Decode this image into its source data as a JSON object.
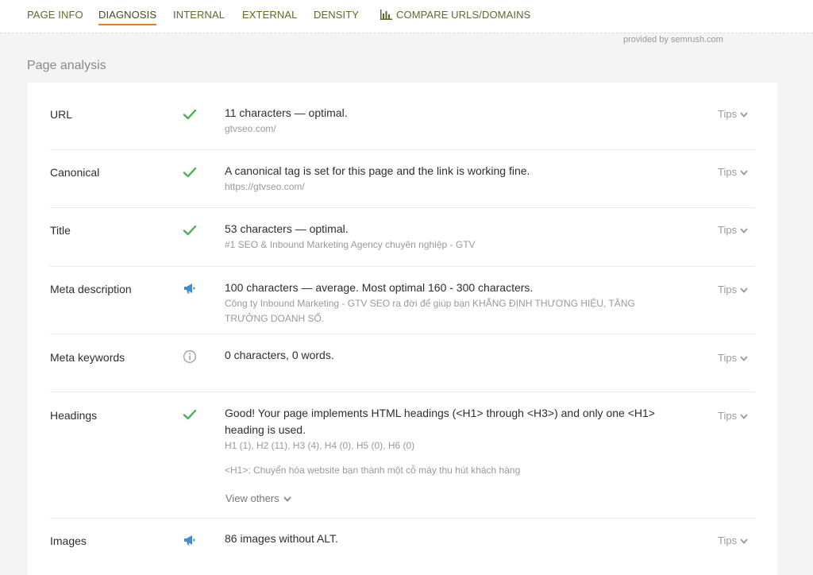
{
  "tabs": [
    {
      "label": "PAGE INFO"
    },
    {
      "label": "DIAGNOSIS"
    },
    {
      "label": "INTERNAL"
    },
    {
      "label": "EXTERNAL"
    },
    {
      "label": "DENSITY"
    },
    {
      "label": "COMPARE URLS/DOMAINS"
    }
  ],
  "active_tab": "DIAGNOSIS",
  "provided_by": "provided by  semrush.com",
  "section_title": "Page analysis",
  "tips_label": "Tips",
  "rows": [
    {
      "label": "URL",
      "status": "check",
      "main": "11 characters — optimal.",
      "sub": "gtvseo.com/"
    },
    {
      "label": "Canonical",
      "status": "check",
      "main": "A canonical tag is set for this page and the link is working fine.",
      "sub": "https://gtvseo.com/"
    },
    {
      "label": "Title",
      "status": "check",
      "main": "53 characters — optimal.",
      "sub": "#1 SEO & Inbound Marketing Agency chuyên nghiệp - GTV"
    },
    {
      "label": "Meta description",
      "status": "warning",
      "main": "100 characters — average. Most optimal 160 - 300 characters.",
      "sub": "Công ty Inbound Marketing - GTV SEO ra đời để giúp bạn KHẲNG ĐỊNH THƯƠNG HIỆU, TĂNG TRƯỞNG DOANH SỐ."
    },
    {
      "label": "Meta keywords",
      "status": "info",
      "main": "0 characters, 0 words.",
      "sub": ""
    },
    {
      "label": "Headings",
      "status": "check",
      "main": "Good! Your page implements HTML headings (<H1> through <H3>) and only one <H1> heading is used.",
      "sub": "H1 (1), H2 (11), H3 (4), H4 (0), H5 (0), H6 (0)",
      "extra": "<H1>: Chuyển hóa website bạn thành một cỗ máy thu hút khách hàng",
      "view_others": "View others"
    },
    {
      "label": "Images",
      "status": "warning",
      "main": "86 images without ALT.",
      "sub": ""
    }
  ],
  "colors": {
    "tab_text": "#5b6b2a",
    "tab_underline": "#ec7b2d",
    "check": "#4caf50",
    "warning": "#3d8fd6",
    "info": "#9e9e9e"
  }
}
